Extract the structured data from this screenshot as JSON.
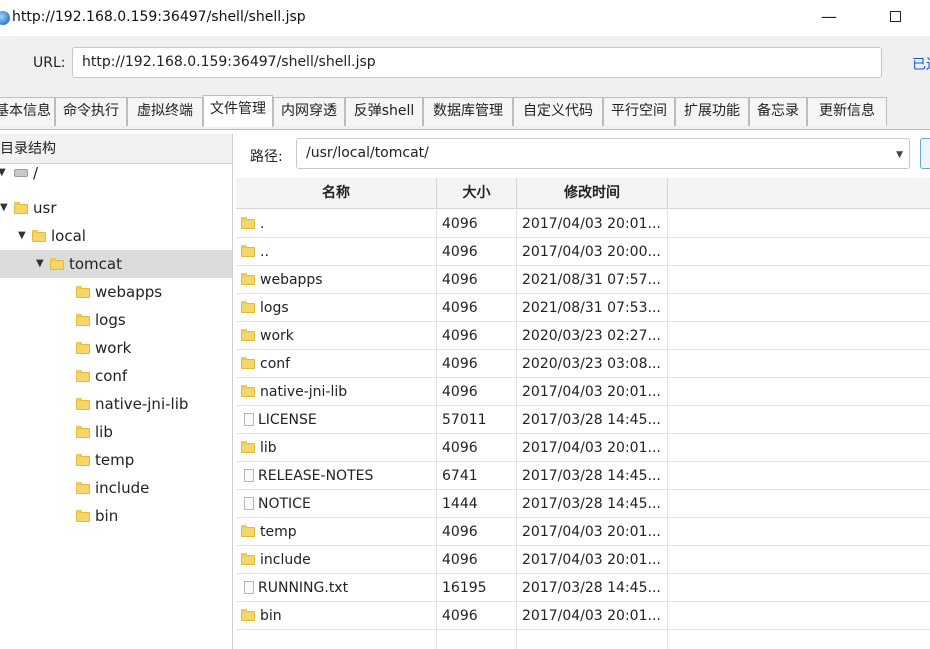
{
  "window": {
    "title": "http://192.168.0.159:36497/shell/shell.jsp",
    "minimize_glyph": "—",
    "url_label": "URL:",
    "url_value": "http://192.168.0.159:36497/shell/shell.jsp",
    "status_text": "已连"
  },
  "tabs": [
    {
      "label": "基本信息",
      "active": false
    },
    {
      "label": "命令执行",
      "active": false
    },
    {
      "label": "虚拟终端",
      "active": false
    },
    {
      "label": "文件管理",
      "active": true
    },
    {
      "label": "内网穿透",
      "active": false
    },
    {
      "label": "反弹shell",
      "active": false
    },
    {
      "label": "数据库管理",
      "active": false
    },
    {
      "label": "自定义代码",
      "active": false
    },
    {
      "label": "平行空间",
      "active": false
    },
    {
      "label": "扩展功能",
      "active": false
    },
    {
      "label": "备忘录",
      "active": false
    },
    {
      "label": "更新信息",
      "active": false
    }
  ],
  "tree": {
    "header": "目录结构",
    "nodes": [
      {
        "label": "/",
        "icon": "drive-icon",
        "expanded": true,
        "selected": false
      },
      {
        "label": "usr",
        "icon": "folder-icon",
        "expanded": true,
        "selected": false
      },
      {
        "label": "local",
        "icon": "folder-icon",
        "expanded": true,
        "selected": false
      },
      {
        "label": "tomcat",
        "icon": "folder-icon",
        "expanded": true,
        "selected": true
      },
      {
        "label": "webapps",
        "icon": "folder-icon",
        "expanded": false,
        "selected": false
      },
      {
        "label": "logs",
        "icon": "folder-icon",
        "expanded": false,
        "selected": false
      },
      {
        "label": "work",
        "icon": "folder-icon",
        "expanded": false,
        "selected": false
      },
      {
        "label": "conf",
        "icon": "folder-icon",
        "expanded": false,
        "selected": false
      },
      {
        "label": "native-jni-lib",
        "icon": "folder-icon",
        "expanded": false,
        "selected": false
      },
      {
        "label": "lib",
        "icon": "folder-icon",
        "expanded": false,
        "selected": false
      },
      {
        "label": "temp",
        "icon": "folder-icon",
        "expanded": false,
        "selected": false
      },
      {
        "label": "include",
        "icon": "folder-icon",
        "expanded": false,
        "selected": false
      },
      {
        "label": "bin",
        "icon": "folder-icon",
        "expanded": false,
        "selected": false
      }
    ]
  },
  "path": {
    "label": "路径:",
    "value": "/usr/local/tomcat/"
  },
  "table": {
    "columns": [
      "名称",
      "大小",
      "修改时间"
    ],
    "rows": [
      {
        "name": ".",
        "type": "folder",
        "size": "4096",
        "modified": "2017/04/03 20:01..."
      },
      {
        "name": "..",
        "type": "folder",
        "size": "4096",
        "modified": "2017/04/03 20:00..."
      },
      {
        "name": "webapps",
        "type": "folder",
        "size": "4096",
        "modified": "2021/08/31 07:57..."
      },
      {
        "name": "logs",
        "type": "folder",
        "size": "4096",
        "modified": "2021/08/31 07:53..."
      },
      {
        "name": "work",
        "type": "folder",
        "size": "4096",
        "modified": "2020/03/23 02:27..."
      },
      {
        "name": "conf",
        "type": "folder",
        "size": "4096",
        "modified": "2020/03/23 03:08..."
      },
      {
        "name": "native-jni-lib",
        "type": "folder",
        "size": "4096",
        "modified": "2017/04/03 20:01..."
      },
      {
        "name": "LICENSE",
        "type": "file",
        "size": "57011",
        "modified": "2017/03/28 14:45..."
      },
      {
        "name": "lib",
        "type": "folder",
        "size": "4096",
        "modified": "2017/04/03 20:01..."
      },
      {
        "name": "RELEASE-NOTES",
        "type": "file",
        "size": "6741",
        "modified": "2017/03/28 14:45..."
      },
      {
        "name": "NOTICE",
        "type": "file",
        "size": "1444",
        "modified": "2017/03/28 14:45..."
      },
      {
        "name": "temp",
        "type": "folder",
        "size": "4096",
        "modified": "2017/04/03 20:01..."
      },
      {
        "name": "include",
        "type": "folder",
        "size": "4096",
        "modified": "2017/04/03 20:01..."
      },
      {
        "name": "RUNNING.txt",
        "type": "file",
        "size": "16195",
        "modified": "2017/03/28 14:45..."
      },
      {
        "name": "bin",
        "type": "folder",
        "size": "4096",
        "modified": "2017/04/03 20:01..."
      }
    ]
  },
  "colors": {
    "accent": "#1a57d6",
    "folder": "#f6d66b",
    "selected_row": "#dcdcdc",
    "panel_bg": "#f0f0f0"
  }
}
